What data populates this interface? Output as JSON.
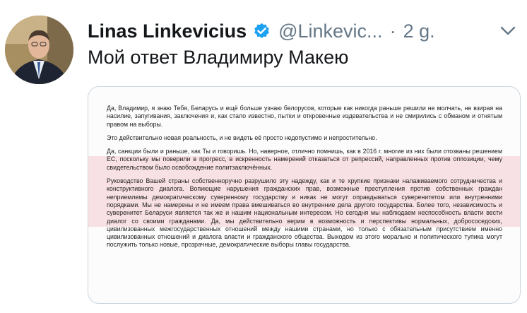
{
  "tweet": {
    "author_name": "Linas Linkevicius",
    "handle": "@Linkevic...",
    "separator": "·",
    "time": "2 g.",
    "text": "Мой ответ Владимиру Макею",
    "icons": {
      "verified": "verified-badge-icon",
      "more": "chevron-down-icon",
      "avatar": "author-avatar-photo"
    },
    "colors": {
      "verified": "#1da1f2",
      "secondary_text": "#657786",
      "primary_text": "#14171a",
      "highlight_band": "#f8e1e4"
    }
  },
  "letter": {
    "paragraphs": [
      "Да, Владимир, я знаю Тебя, Беларусь и ещё больше узнаю белорусов, которые как никогда раньше решили не молчать, не взирая на насилие, запугивания, заключения и, как стало известно, пытки и откровенные издевательства и не смирились с обманом и отнятым правом на выборы.",
      "Это действительно новая реальность, и не видеть её просто недопустимо и непростительно.",
      "Да, санкции были и раньше, как Ты и говоришь. Но, наверное, отлично помнишь, как в 2016 г. многие из них были отозваны решением ЕС, поскольку мы поверили в прогресс, в искренность намерений отказаться от репрессий, направленных против оппозиции, чему свидетельством было освобождение политзаключённых.",
      "Руководство Вашей страны собственноручно разрушило эту надежду, как и те хрупкие признаки налаживаемого сотрудничества и конструктивного диалога. Вопиющие нарушения гражданских прав, возможные преступления против собственных граждан неприемлемы демократическому суверенному государству и никак не могут оправдываться суверенитетом или внутренними порядками. Мы не намерены и не имеем права вмешиваться во внутренние дела другого государства. Более того, независимость и суверенитет Беларуси является так же и нашим национальным интересом. Но сегодня мы наблюдаем неспособность власти вести диалог со своими гражданами. Да, мы действительно верим в возможность и перспективы нормальных, добрососедских, цивилизованных межгосударственных отношений между нашими странами, но только с обязательным присутствием именно цивилизованных отношений и диалога власти и гражданского общества. Выходом из этого морально и политического тупика могут послужить только новые, прозрачные, демократические выборы главы государства."
    ]
  }
}
